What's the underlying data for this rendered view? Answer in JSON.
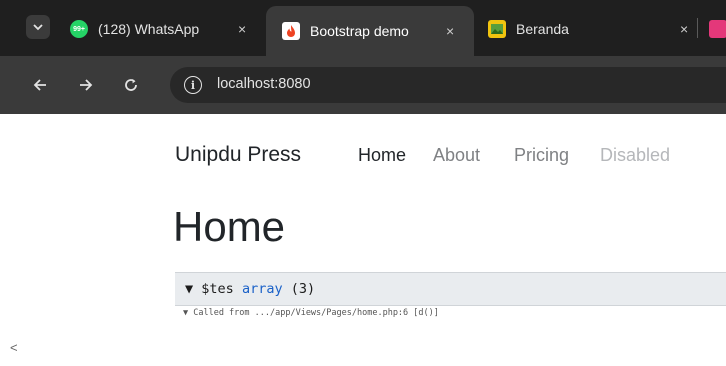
{
  "browser": {
    "tabs": [
      {
        "title": "(128) WhatsApp",
        "badge": "99+",
        "active": false
      },
      {
        "title": "Bootstrap demo",
        "active": true
      },
      {
        "title": "Beranda",
        "active": false
      }
    ],
    "close_glyph": "×",
    "address": "localhost:8080"
  },
  "page": {
    "brand": "Unipdu Press",
    "nav": [
      "Home",
      "About",
      "Pricing",
      "Disabled"
    ],
    "heading": "Home",
    "debug": {
      "toggle": "▼",
      "variable": "$tes",
      "type": "array",
      "count": "(3)",
      "called_from": "▼ Called from .../app/Views/Pages/home.php:6 [d()]"
    },
    "stray_text": "<"
  },
  "colors": {
    "tab_strip": "#1f1f1f",
    "toolbar": "#3a3a3a",
    "debug_type": "#1a61c8",
    "nav_muted": "#7f8184",
    "nav_disabled": "#b5b7ba"
  }
}
